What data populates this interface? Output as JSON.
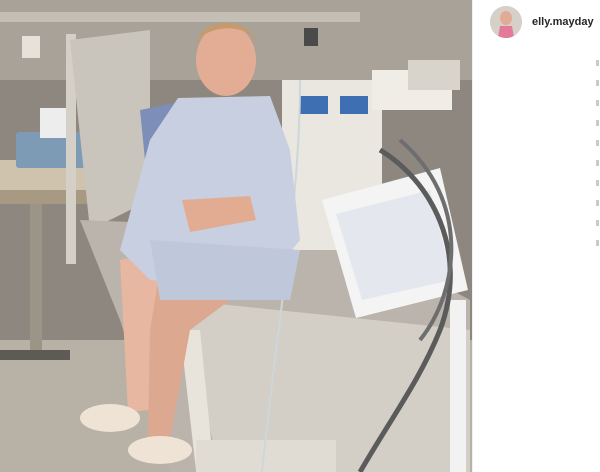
{
  "post": {
    "username": "elly.mayday",
    "avatar_icon": "profile-avatar-icon",
    "photo_subject": "post-photo"
  },
  "colors": {
    "sidebar_bg": "#ffffff",
    "username_text": "#262626",
    "room_wall": "#8f8a82"
  }
}
